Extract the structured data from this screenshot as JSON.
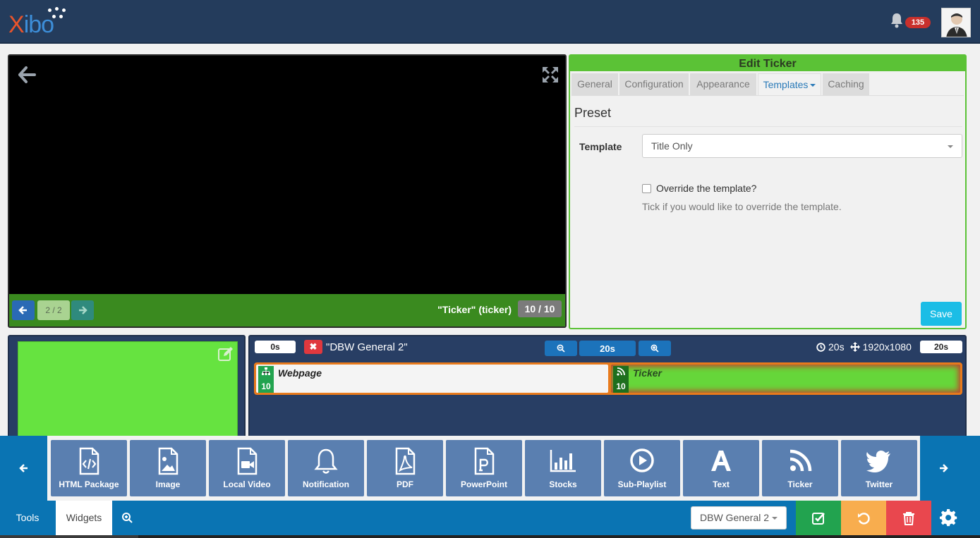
{
  "app": {
    "logo_text": "Xibo",
    "notification_count": "135"
  },
  "preview": {
    "page_indicator": "2 / 2",
    "widget_name": "\"Ticker\" (ticker)",
    "widget_count": "10 / 10"
  },
  "edit_panel": {
    "title": "Edit Ticker",
    "tabs": [
      {
        "label": "General"
      },
      {
        "label": "Configuration"
      },
      {
        "label": "Appearance"
      },
      {
        "label": "Templates",
        "active": true
      },
      {
        "label": "Caching"
      }
    ],
    "section_title": "Preset",
    "template_label": "Template",
    "template_value": "Title Only",
    "override_label": "Override the template?",
    "override_checked": false,
    "override_help": "Tick if you would like to override the template.",
    "save_label": "Save"
  },
  "timeline": {
    "start_time": "0s",
    "region_name": "\"DBW General 2\"",
    "zoom_level": "20s",
    "duration": "20s",
    "resolution": "1920x1080",
    "end_time": "20s",
    "widgets": [
      {
        "name": "Webpage",
        "duration": "10"
      },
      {
        "name": "Ticker",
        "duration": "10"
      }
    ]
  },
  "toolbox": {
    "items": [
      {
        "label": "HTML Package",
        "icon": "html-package-icon"
      },
      {
        "label": "Image",
        "icon": "image-icon"
      },
      {
        "label": "Local Video",
        "icon": "local-video-icon"
      },
      {
        "label": "Notification",
        "icon": "bell-icon"
      },
      {
        "label": "PDF",
        "icon": "pdf-icon"
      },
      {
        "label": "PowerPoint",
        "icon": "powerpoint-icon"
      },
      {
        "label": "Stocks",
        "icon": "bar-chart-icon"
      },
      {
        "label": "Sub-Playlist",
        "icon": "play-circle-icon"
      },
      {
        "label": "Text",
        "icon": "text-icon"
      },
      {
        "label": "Ticker",
        "icon": "rss-icon"
      },
      {
        "label": "Twitter",
        "icon": "twitter-icon"
      }
    ]
  },
  "bottombar": {
    "tools_label": "Tools",
    "widgets_label": "Widgets",
    "layout_select_value": "DBW General 2"
  },
  "colors": {
    "navbar": "#243c5c",
    "accent_green": "#5bc236",
    "toolbar_blue": "#0a74b3",
    "timeline_bg": "#283e64",
    "track_orange": "#e87a1c"
  }
}
